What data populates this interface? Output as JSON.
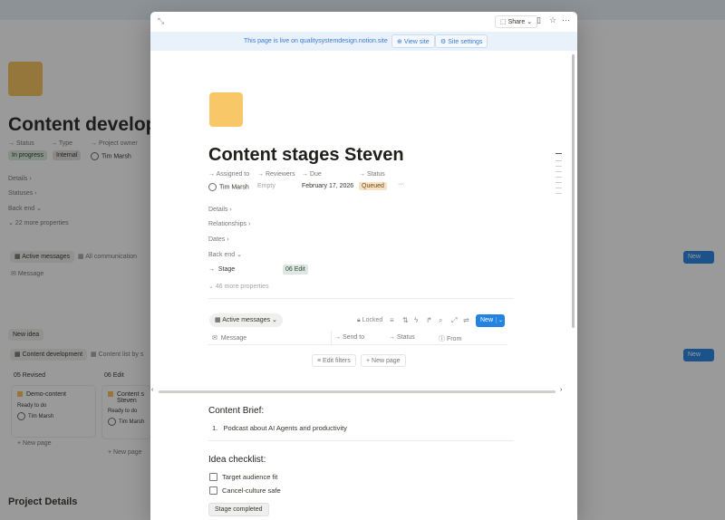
{
  "background": {
    "title": "Content developm",
    "props": {
      "status_label": "Status",
      "type_label": "Type",
      "owner_label": "Project owner",
      "status_value": "In progress",
      "type_value": "Internal",
      "owner_value": "Tim Marsh"
    },
    "sections": [
      "Details",
      "Statuses",
      "Back end"
    ],
    "more_props": "22 more properties",
    "tabs": {
      "active": "Active messages",
      "other": "All communication"
    },
    "message_col": "Message",
    "new_idea": "New idea",
    "board_tabs": {
      "active": "Content development",
      "other": "Content list by s"
    },
    "groups": [
      "05 Revised",
      "06 Edit"
    ],
    "cards": [
      {
        "title": "Demo-content",
        "status": "Ready to do",
        "owner": "Tim Marsh"
      },
      {
        "title": "Content s",
        "title2": "Steven",
        "status": "Ready to do",
        "owner": "Tim Marsh"
      }
    ],
    "new_page": "New page",
    "new_label": "New",
    "project_details": "Project Details"
  },
  "modal": {
    "share_label": "Share",
    "live_text": "This page is live on qualitysystemdesign.notion.site",
    "view_site": "View site",
    "site_settings": "Site settings",
    "title": "Content stages Steven",
    "properties": [
      {
        "label": "Assigned to",
        "value": "Tim Marsh"
      },
      {
        "label": "Reviewers",
        "value": "Empty"
      },
      {
        "label": "Due",
        "value": "February 17, 2026"
      },
      {
        "label": "Status",
        "value": "Queued"
      }
    ],
    "more_dots": "···",
    "sections": [
      "Details",
      "Relationships",
      "Dates",
      "Back end"
    ],
    "stage_label": "Stage",
    "stage_value": "06 Edit",
    "more_properties": "46 more properties",
    "view_tab": "Active messages",
    "locked": "Locked",
    "new_label": "New",
    "columns": [
      "Message",
      "Send to",
      "Status",
      "From"
    ],
    "edit_filters": "Edit filters",
    "new_page": "New page",
    "brief_heading": "Content Brief:",
    "brief_items": [
      "Podcast about AI Agents and productivity"
    ],
    "checklist_heading": "Idea checklist:",
    "checklist": [
      "Target audience fit",
      "Cancel-culture safe"
    ],
    "stage_completed": "Stage completed"
  },
  "colors": {
    "accent": "#2383e2",
    "icon": "#f8c868",
    "queued_bg": "#f6e2c6"
  }
}
